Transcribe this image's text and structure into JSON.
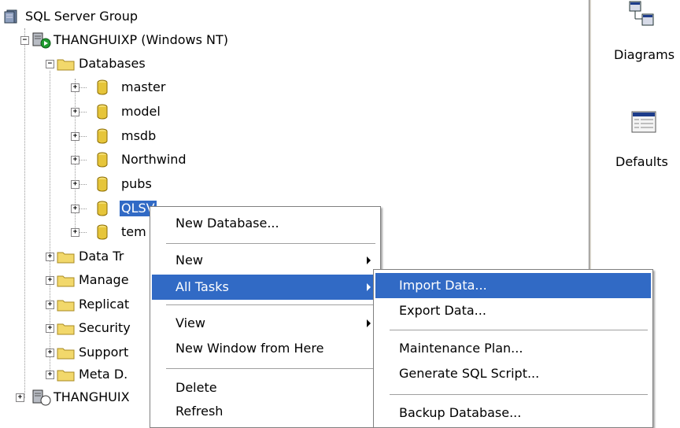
{
  "tree": {
    "root": "SQL Server Group",
    "server1": "THANGHUIXP (Windows NT)",
    "databases": "Databases",
    "db_items": [
      "master",
      "model",
      "msdb",
      "Northwind",
      "pubs",
      "QLSV",
      "tem"
    ],
    "folders": [
      "Data Tr",
      "Manage",
      "Replicat",
      "Security",
      "Support",
      "Meta D."
    ],
    "server2": "THANGHUIX"
  },
  "right_panel": {
    "items": [
      "Diagrams",
      "Defaults"
    ]
  },
  "context_menu": {
    "items": [
      "New Database...",
      "New",
      "All Tasks",
      "View",
      "New Window from Here",
      "Delete",
      "Refresh"
    ]
  },
  "submenu": {
    "items": [
      "Import Data...",
      "Export Data...",
      "Maintenance Plan...",
      "Generate SQL Script...",
      "Backup Database..."
    ]
  },
  "colors": {
    "highlight": "#316ac5",
    "folder": "#f2d86b",
    "db_cylinder": "#e6c53a"
  }
}
